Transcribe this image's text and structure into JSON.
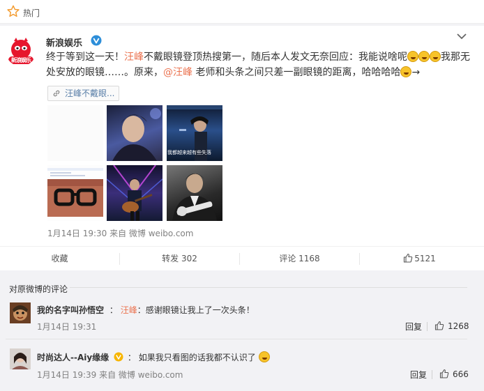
{
  "hot": {
    "label": "热门"
  },
  "post": {
    "author": "新浪娱乐",
    "avatar_text": "新浪娱乐",
    "text_segments": [
      {
        "t": "终于等到这一天！",
        "cls": ""
      },
      {
        "t": "汪峰",
        "cls": "hl"
      },
      {
        "t": "不戴眼镜登顶热搜第一，随后本人发文无奈回应：我能说啥呢",
        "cls": ""
      },
      {
        "t": "",
        "cls": "emoji"
      },
      {
        "t": "",
        "cls": "emoji"
      },
      {
        "t": "",
        "cls": "emoji"
      },
      {
        "t": "我那无处安放的眼镜……。原来，",
        "cls": ""
      },
      {
        "t": "@汪峰",
        "cls": "link"
      },
      {
        "t": " 老师和头条之间只差一副眼镜的距离，哈哈哈哈",
        "cls": ""
      },
      {
        "t": "",
        "cls": "emoji"
      },
      {
        "t": "→",
        "cls": ""
      }
    ],
    "tag_chip": "汪峰不戴眼...",
    "thumb_caption": "我都越来越有些失落",
    "meta": "1月14日 19:30 来自 微博 weibo.com"
  },
  "actions": {
    "favorite": "收藏",
    "repost": "转发 302",
    "comment": "评论 1168",
    "like": "5121"
  },
  "comments": {
    "title": "对原微博的评论",
    "items": [
      {
        "name": "我的名字叫孙悟空",
        "colon": "：",
        "mention": "汪峰",
        "text": "：感谢眼镜让我上了一次头条！",
        "time": "1月14日 19:31",
        "reply": "回复",
        "likes": "1268"
      },
      {
        "name": "时尚达人--Aiy缘缘",
        "colon": "：",
        "mention": "",
        "text": "如果我只看图的话我都不认识了",
        "time": "1月14日 19:39 来自 微博 weibo.com",
        "reply": "回复",
        "likes": "666"
      }
    ]
  },
  "colors": {
    "accent": "#eb7350",
    "link": "#5a7fa8",
    "verified_blue": "#2d8ed9",
    "verified_gold": "#f7b500",
    "meta_gray": "#808080"
  }
}
